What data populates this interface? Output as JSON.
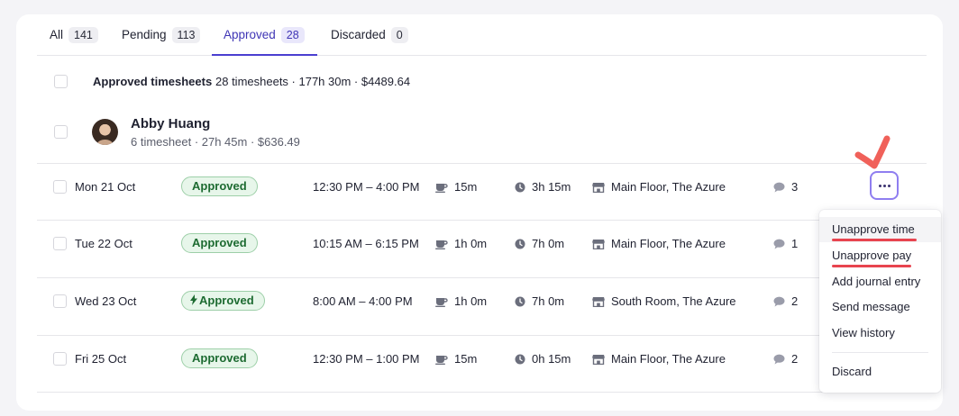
{
  "tabs": [
    {
      "label": "All",
      "count": "141"
    },
    {
      "label": "Pending",
      "count": "113"
    },
    {
      "label": "Approved",
      "count": "28"
    },
    {
      "label": "Discarded",
      "count": "0"
    }
  ],
  "summary": {
    "title": "Approved timesheets",
    "stats": "28 timesheets · 177h 30m · $4489.64"
  },
  "person": {
    "name": "Abby Huang",
    "stats": "6 timesheet · 27h 45m · $636.49"
  },
  "rows": [
    {
      "date": "Mon 21 Oct",
      "status": "Approved",
      "time": "12:30 PM – 4:00 PM",
      "break": "15m",
      "duration": "3h 15m",
      "location": "Main Floor, The Azure",
      "comments": "3"
    },
    {
      "date": "Tue 22 Oct",
      "status": "Approved",
      "time": "10:15 AM – 6:15 PM",
      "break": "1h 0m",
      "duration": "7h 0m",
      "location": "Main Floor, The Azure",
      "comments": "1"
    },
    {
      "date": "Wed 23 Oct",
      "status": "Approved",
      "time": "8:00 AM – 4:00 PM",
      "break": "1h 0m",
      "duration": "7h 0m",
      "location": "South Room, The Azure",
      "comments": "2"
    },
    {
      "date": "Fri 25 Oct",
      "status": "Approved",
      "time": "12:30 PM – 1:00 PM",
      "break": "15m",
      "duration": "0h 15m",
      "location": "Main Floor, The Azure",
      "comments": "2"
    }
  ],
  "menu": {
    "items": [
      "Unapprove time",
      "Unapprove pay",
      "Add journal entry",
      "Send message",
      "View history"
    ],
    "danger": "Discard"
  },
  "icons": {
    "break": "coffee-cup-icon",
    "duration": "clock-icon",
    "location": "storefront-icon",
    "comments": "speech-bubble-icon",
    "auto_approved": "lightning-bolt-icon"
  },
  "colors": {
    "accent": "#4a3fd0",
    "approved_bg": "#e7f6ea",
    "approved_text": "#1d6b31",
    "annotation": "#e8444f"
  }
}
